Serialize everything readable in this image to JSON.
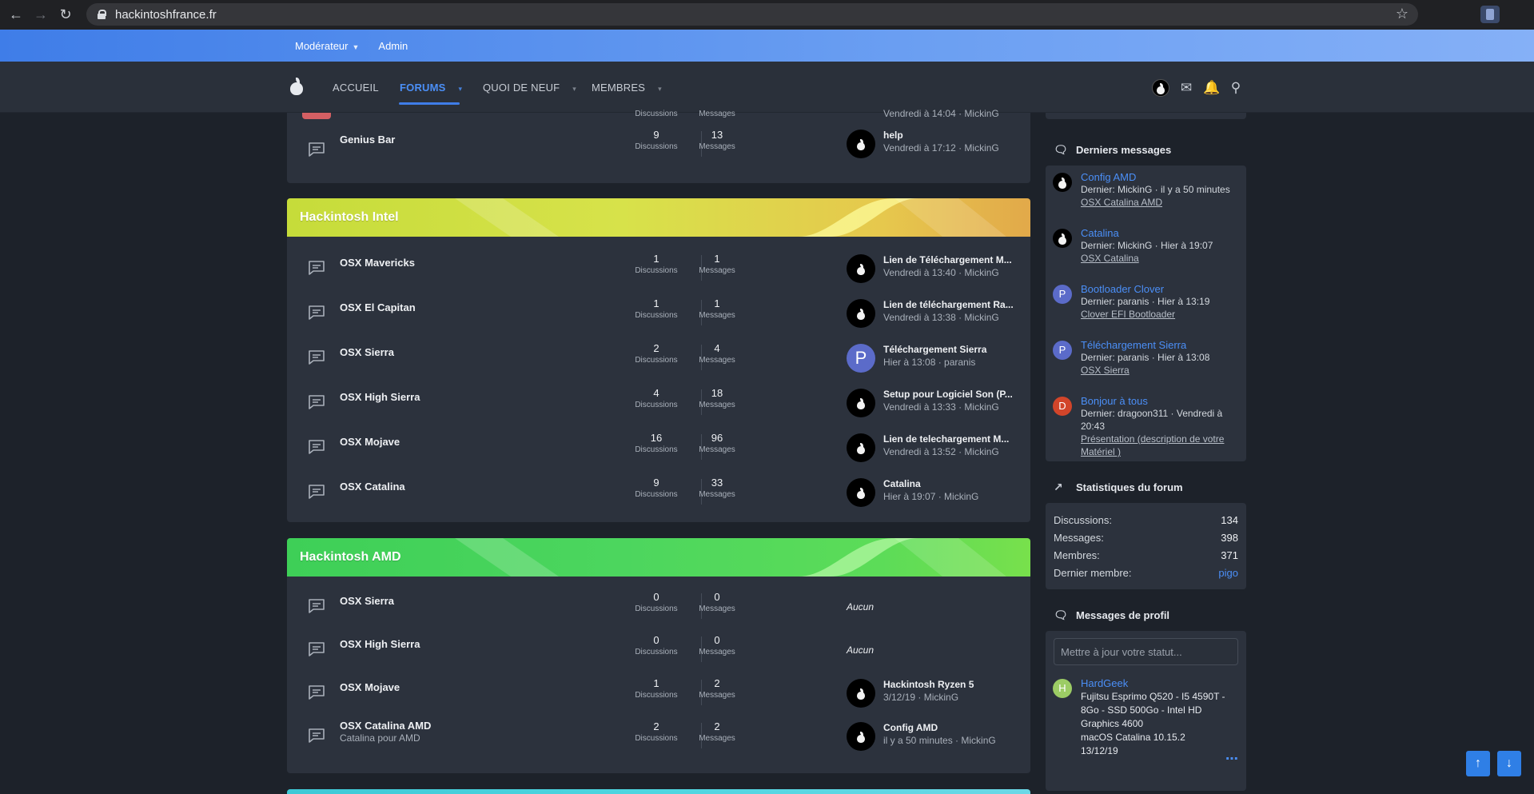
{
  "browser": {
    "url": "hackintoshfrance.fr"
  },
  "staffbar": {
    "moderator": "Modérateur",
    "admin": "Admin"
  },
  "nav": {
    "home": "ACCUEIL",
    "forums": "FORUMS",
    "whats_new": "QUOI DE NEUF",
    "members": "MEMBRES"
  },
  "labels": {
    "discussions": "Discussions",
    "messages": "Messages",
    "none": "Aucun"
  },
  "top_partial": {
    "discussions_label": "Discussions",
    "messages_label": "Messages",
    "meta": "Vendredi à 14:04 · MickinG"
  },
  "genius_bar": {
    "title": "Genius Bar",
    "discussions": "9",
    "messages": "13",
    "last_title": "help",
    "last_meta": "Vendredi à 17:12 · MickinG"
  },
  "categories": [
    {
      "title": "Hackintosh Intel",
      "nodes": [
        {
          "title": "OSX Mavericks",
          "discussions": "1",
          "messages": "1",
          "last_title": "Lien de Téléchargement M...",
          "last_meta": "Vendredi à 13:40 · MickinG",
          "avatar": "apple"
        },
        {
          "title": "OSX El Capitan",
          "discussions": "1",
          "messages": "1",
          "last_title": "Lien de téléchargement Ra...",
          "last_meta": "Vendredi à 13:38 · MickinG",
          "avatar": "apple"
        },
        {
          "title": "OSX Sierra",
          "discussions": "2",
          "messages": "4",
          "last_title": "Téléchargement Sierra",
          "last_meta": "Hier à 13:08 · paranis",
          "avatar": "P"
        },
        {
          "title": "OSX High Sierra",
          "discussions": "4",
          "messages": "18",
          "last_title": "Setup pour Logiciel Son (P...",
          "last_meta": "Vendredi à 13:33 · MickinG",
          "avatar": "apple"
        },
        {
          "title": "OSX Mojave",
          "discussions": "16",
          "messages": "96",
          "last_title": "Lien de telechargement M...",
          "last_meta": "Vendredi à 13:52 · MickinG",
          "avatar": "apple"
        },
        {
          "title": "OSX Catalina",
          "discussions": "9",
          "messages": "33",
          "last_title": "Catalina",
          "last_meta": "Hier à 19:07 · MickinG",
          "avatar": "apple"
        }
      ]
    },
    {
      "title": "Hackintosh AMD",
      "nodes": [
        {
          "title": "OSX Sierra",
          "discussions": "0",
          "messages": "0",
          "none": "Aucun"
        },
        {
          "title": "OSX High Sierra",
          "discussions": "0",
          "messages": "0",
          "none": "Aucun"
        },
        {
          "title": "OSX Mojave",
          "discussions": "1",
          "messages": "2",
          "last_title": "Hackintosh Ryzen 5",
          "last_meta": "3/12/19 · MickinG",
          "avatar": "apple"
        },
        {
          "title": "OSX Catalina AMD",
          "desc": "Catalina pour AMD",
          "discussions": "2",
          "messages": "2",
          "last_title": "Config AMD",
          "last_meta": "il y a 50 minutes · MickinG",
          "avatar": "apple"
        }
      ]
    }
  ],
  "sidebar": {
    "latest": {
      "title": "Derniers messages",
      "items": [
        {
          "title": "Config AMD",
          "meta": "Dernier: MickinG · il y a 50 minutes",
          "forum": "OSX Catalina AMD",
          "avatar": "apple",
          "color": "#000000"
        },
        {
          "title": "Catalina",
          "meta": "Dernier: MickinG · Hier à 19:07",
          "forum": "OSX Catalina",
          "avatar": "apple",
          "color": "#000000"
        },
        {
          "title": "Bootloader Clover",
          "meta": "Dernier: paranis · Hier à 13:19",
          "forum": "Clover EFI Bootloader",
          "avatar": "P",
          "color": "#5b6bc9"
        },
        {
          "title": "Téléchargement Sierra",
          "meta": "Dernier: paranis · Hier à 13:08",
          "forum": "OSX Sierra",
          "avatar": "P",
          "color": "#5b6bc9"
        },
        {
          "title": "Bonjour à tous",
          "meta": "Dernier: dragoon311 · Vendredi à 20:43",
          "forum": "Présentation (description de votre Matériel )",
          "avatar": "D",
          "color": "#d2452a"
        }
      ]
    },
    "stats": {
      "title": "Statistiques du forum",
      "discussions_label": "Discussions:",
      "discussions": "134",
      "messages_label": "Messages:",
      "messages": "398",
      "members_label": "Membres:",
      "members": "371",
      "latest_member_label": "Dernier membre:",
      "latest_member": "pigo"
    },
    "profile": {
      "title": "Messages de profil",
      "placeholder": "Mettre à jour votre statut...",
      "post_author": "HardGeek",
      "post_text": "Fujitsu Esprimo Q520 - I5 4590T - 8Go - SSD 500Go - Intel HD Graphics 4600",
      "post_text2": "macOS Catalina 10.15.2",
      "post_date": "13/12/19",
      "avatar": "H"
    }
  },
  "colors": {
    "accent": "#4b8ff7",
    "intel": "#c6dc3a",
    "amd": "#3ecf57"
  }
}
